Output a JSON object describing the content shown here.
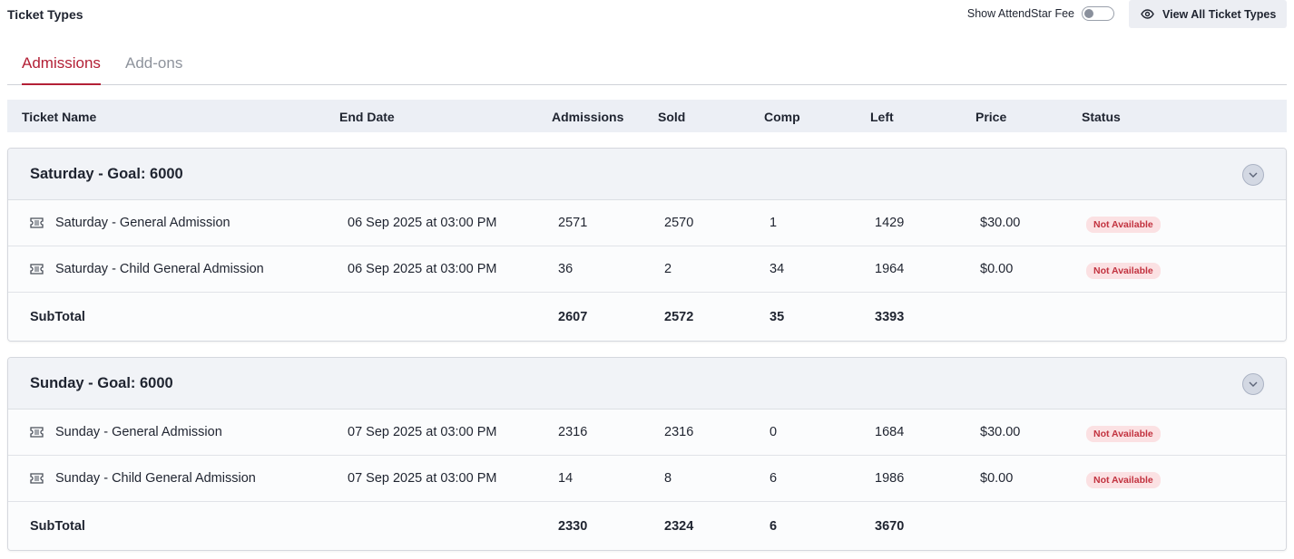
{
  "header": {
    "title": "Ticket Types",
    "fee_toggle_label": "Show AttendStar Fee",
    "fee_toggle_on": false,
    "view_all_label": "View All Ticket Types"
  },
  "tabs": [
    {
      "label": "Admissions",
      "active": true
    },
    {
      "label": "Add-ons",
      "active": false
    }
  ],
  "columns": [
    "Ticket Name",
    "End Date",
    "Admissions",
    "Sold",
    "Comp",
    "Left",
    "Price",
    "Status"
  ],
  "groups": [
    {
      "title": "Saturday - Goal: 6000",
      "rows": [
        {
          "name": "Saturday - General Admission",
          "end_date": "06 Sep 2025 at 03:00 PM",
          "admissions": "2571",
          "sold": "2570",
          "comp": "1",
          "left": "1429",
          "price": "$30.00",
          "status": "Not Available"
        },
        {
          "name": "Saturday - Child General Admission",
          "end_date": "06 Sep 2025 at 03:00 PM",
          "admissions": "36",
          "sold": "2",
          "comp": "34",
          "left": "1964",
          "price": "$0.00",
          "status": "Not Available"
        }
      ],
      "subtotal": {
        "label": "SubTotal",
        "admissions": "2607",
        "sold": "2572",
        "comp": "35",
        "left": "3393"
      }
    },
    {
      "title": "Sunday - Goal: 6000",
      "rows": [
        {
          "name": "Sunday - General Admission",
          "end_date": "07 Sep 2025 at 03:00 PM",
          "admissions": "2316",
          "sold": "2316",
          "comp": "0",
          "left": "1684",
          "price": "$30.00",
          "status": "Not Available"
        },
        {
          "name": "Sunday - Child General Admission",
          "end_date": "07 Sep 2025 at 03:00 PM",
          "admissions": "14",
          "sold": "8",
          "comp": "6",
          "left": "1986",
          "price": "$0.00",
          "status": "Not Available"
        }
      ],
      "subtotal": {
        "label": "SubTotal",
        "admissions": "2330",
        "sold": "2324",
        "comp": "6",
        "left": "3670"
      }
    }
  ],
  "colors": {
    "accent": "#b32036",
    "badge_bg": "#fbe1e3",
    "badge_text": "#c2323f"
  },
  "icons": {
    "view_all": "eye-icon",
    "ticket": "ticket-icon",
    "collapse": "chevron-down-icon"
  }
}
